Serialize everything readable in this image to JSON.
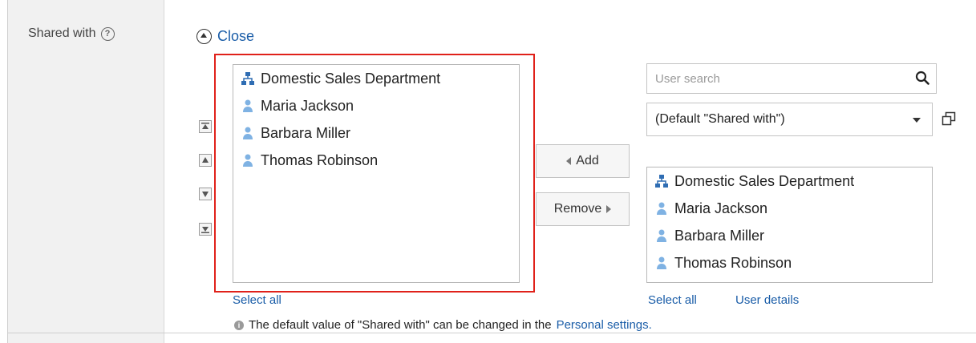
{
  "field": {
    "label": "Shared with",
    "help_icon": "question-circle-icon"
  },
  "toggle": {
    "label": "Close",
    "icon": "circle-chevron-up-icon"
  },
  "left_list": {
    "items": [
      {
        "label": "Domestic Sales Department",
        "icon": "org-chart-icon"
      },
      {
        "label": "Maria Jackson",
        "icon": "user-icon"
      },
      {
        "label": "Barbara Miller",
        "icon": "user-icon"
      },
      {
        "label": "Thomas Robinson",
        "icon": "user-icon"
      }
    ],
    "select_all": "Select all"
  },
  "order_buttons": [
    "move-top-icon",
    "move-up-icon",
    "move-down-icon",
    "move-bottom-icon"
  ],
  "buttons": {
    "add": "Add",
    "remove": "Remove"
  },
  "search": {
    "placeholder": "User search"
  },
  "dropdown": {
    "selected": "(Default \"Shared with\")"
  },
  "right_list": {
    "items": [
      {
        "label": "Domestic Sales Department",
        "icon": "org-chart-icon"
      },
      {
        "label": "Maria Jackson",
        "icon": "user-icon"
      },
      {
        "label": "Barbara Miller",
        "icon": "user-icon"
      },
      {
        "label": "Thomas Robinson",
        "icon": "user-icon"
      }
    ],
    "select_all": "Select all",
    "user_details": "User details"
  },
  "note": {
    "text": "The default value of \"Shared with\" can be changed in the",
    "link": "Personal settings."
  },
  "colors": {
    "link": "#1a5da8",
    "highlight": "#e0211a",
    "org_icon": "#2f6db3",
    "user_icon": "#7fb2e3"
  }
}
